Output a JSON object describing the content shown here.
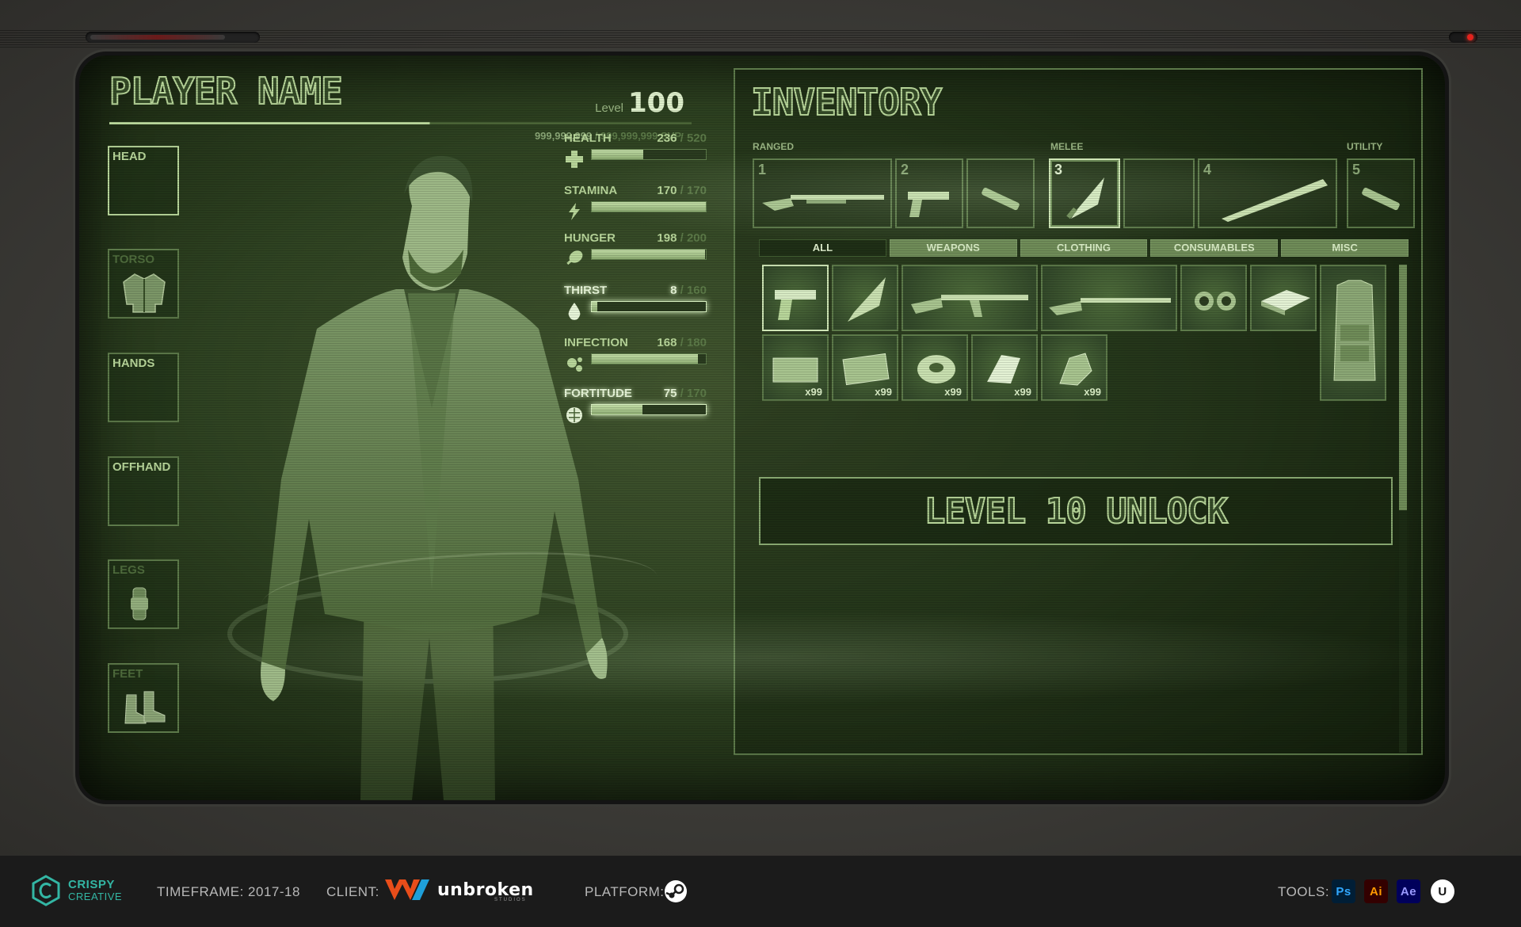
{
  "player": {
    "name": "PLAYER NAME",
    "level_label": "Level",
    "level_value": "100",
    "svp_current": "999,999,999",
    "svp_sep": " / ",
    "svp_max": "999,999,999 SVP"
  },
  "equipment_slots": [
    {
      "label": "HEAD",
      "icon": "empty-slot"
    },
    {
      "label": "TORSO",
      "icon": "jacket-icon"
    },
    {
      "label": "HANDS",
      "icon": "empty-slot"
    },
    {
      "label": "OFFHAND",
      "icon": "empty-slot"
    },
    {
      "label": "LEGS",
      "icon": "watch-icon"
    },
    {
      "label": "FEET",
      "icon": "boots-icon"
    }
  ],
  "stats": [
    {
      "name": "HEALTH",
      "value": "236",
      "max": "/ 520",
      "fraction": 0.454,
      "icon": "health-cross-icon"
    },
    {
      "name": "STAMINA",
      "value": "170",
      "max": "/ 170",
      "fraction": 1.0,
      "icon": "lightning-icon"
    },
    {
      "name": "HUNGER",
      "value": "198",
      "max": "/ 200",
      "fraction": 0.99,
      "icon": "drumstick-icon"
    },
    {
      "name": "THIRST",
      "value": "8",
      "max": "/ 160",
      "fraction": 0.05,
      "icon": "water-drop-icon"
    },
    {
      "name": "INFECTION",
      "value": "168",
      "max": "/ 180",
      "fraction": 0.933,
      "icon": "spore-icon"
    },
    {
      "name": "FORTITUDE",
      "value": "75",
      "max": "/ 170",
      "fraction": 0.441,
      "icon": "brain-icon"
    }
  ],
  "inventory": {
    "title": "INVENTORY",
    "quick_labels": {
      "ranged": "RANGED",
      "melee": "MELEE",
      "utility": "UTILITY"
    },
    "quick_slots": [
      {
        "num": "1",
        "item": "shotgun-icon"
      },
      {
        "num": "2",
        "item": "pistol-icon"
      },
      {
        "num": "",
        "item": "flashlight-icon"
      },
      {
        "num": "3",
        "item": "knife-icon"
      },
      {
        "num": "",
        "item": "empty"
      },
      {
        "num": "4",
        "item": "bat-icon"
      },
      {
        "num": "5",
        "item": "flashlight-icon"
      }
    ],
    "tabs": [
      "ALL",
      "WEAPONS",
      "CLOTHING",
      "CONSUMABLES",
      "MISC"
    ],
    "items_row1": [
      "pistol-icon",
      "knife-icon",
      "rifle-icon",
      "shotgun-icon",
      "binoculars-icon",
      "book-icon"
    ],
    "items_row2": [
      {
        "icon": "ammo-box-icon",
        "qty": "x99"
      },
      {
        "icon": "ammo-box-icon",
        "qty": "x99"
      },
      {
        "icon": "tape-roll-icon",
        "qty": "x99"
      },
      {
        "icon": "bandage-icon",
        "qty": "x99"
      },
      {
        "icon": "parts-icon",
        "qty": "x99"
      }
    ],
    "armor_item": "vest-icon",
    "locked_text": "LEVEL 10 UNLOCK"
  },
  "footer": {
    "brand_line1": "CRISPY",
    "brand_line2": "CREATIVE",
    "timeframe": "TIMEFRAME: 2017-18",
    "client_label": "CLIENT:",
    "client_name": "unbroken",
    "client_sub": "STUDIOS",
    "platform_label": "PLATFORM:",
    "platform_icon": "steam-icon",
    "tools_label": "TOOLS:",
    "tools": [
      {
        "abbr": "Ps",
        "bg": "#001e36",
        "fg": "#31a8ff"
      },
      {
        "abbr": "Ai",
        "bg": "#330000",
        "fg": "#ff9a00"
      },
      {
        "abbr": "Ae",
        "bg": "#00005b",
        "fg": "#9999ff"
      },
      {
        "abbr": "U",
        "bg": "#ffffff",
        "fg": "#111111"
      }
    ]
  },
  "colors": {
    "phosphor": "#b8d69a",
    "screen_dark": "#1c2a13",
    "led": "#e3221c",
    "brand": "#33b6a4"
  }
}
